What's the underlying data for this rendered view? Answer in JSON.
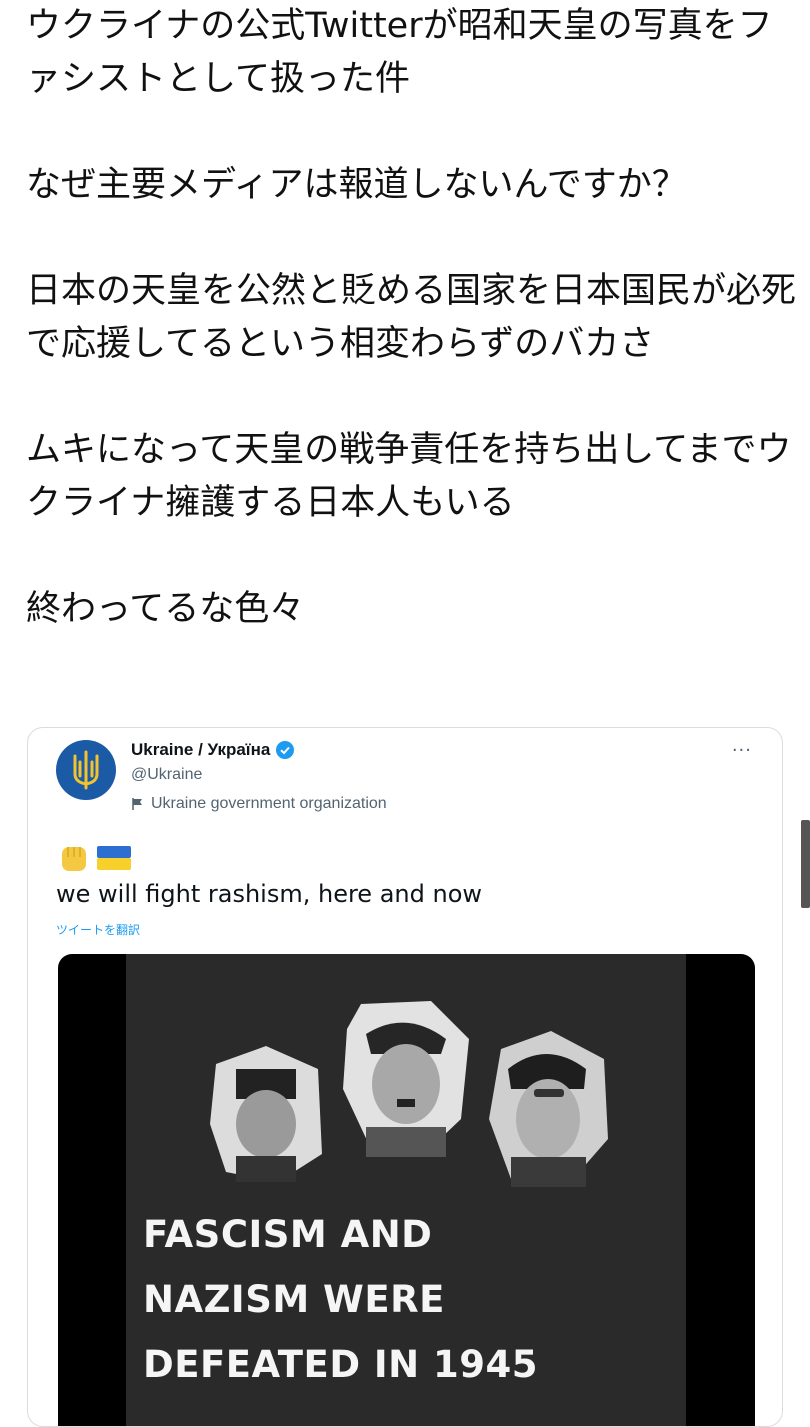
{
  "post": {
    "paragraphs": [
      "ウクライナの公式Twitterが昭和天皇の写真をファシストとして扱った件",
      "なぜ主要メディアは報道しないんですか？",
      "日本の天皇を公然と貶める国家を日本国民が必死で応援してるという相変わらずのバカさ",
      "ムキになって天皇の戦争責任を持ち出してまでウクライナ擁護する日本人もいる",
      "終わってるな色々"
    ]
  },
  "embed": {
    "display_name": "Ukraine / Україна",
    "handle": "@Ukraine",
    "affiliation": "Ukraine government organization",
    "more_label": "···",
    "tweet_text": "we will fight rashism, here and now",
    "translate_label": "ツイートを翻訳",
    "media_text": [
      "FASCISM AND",
      "NAZISM WERE",
      "DEFEATED IN 1945"
    ],
    "icons": {
      "avatar": "ukraine-trident-icon",
      "verified": "verified-badge-icon",
      "affiliation": "flag-icon",
      "emoji1": "raised-fist-icon",
      "emoji2": "ukraine-flag-icon"
    }
  },
  "colors": {
    "link": "#1d9bf0",
    "muted": "#536471",
    "avatar_bg": "#1b5ba5",
    "trident": "#f2c230"
  }
}
